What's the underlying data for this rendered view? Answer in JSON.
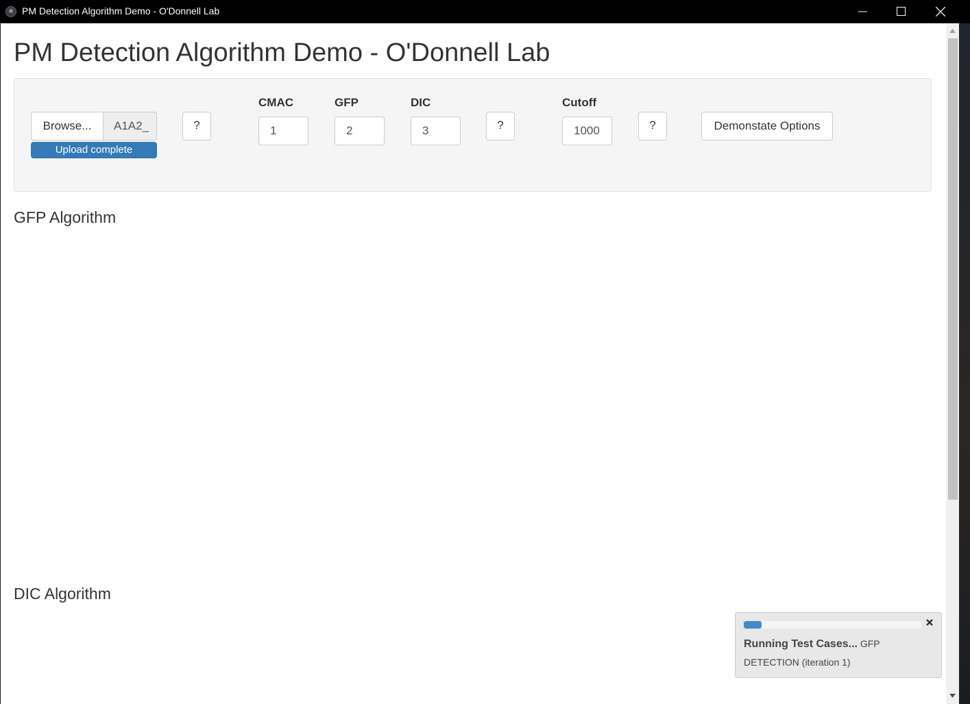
{
  "window": {
    "title": "PM Detection Algorithm Demo - O'Donnell Lab"
  },
  "page": {
    "heading": "PM Detection Algorithm Demo - O'Donnell Lab"
  },
  "controls": {
    "browse_label": "Browse...",
    "file_name": "A1A2_",
    "upload_status": "Upload complete",
    "upload_progress_percent": 100,
    "help_label": "?",
    "cmac": {
      "label": "CMAC",
      "value": "1"
    },
    "gfp": {
      "label": "GFP",
      "value": "2"
    },
    "dic": {
      "label": "DIC",
      "value": "3"
    },
    "cutoff": {
      "label": "Cutoff",
      "value": "1000"
    },
    "demo_button": "Demonstate Options"
  },
  "sections": {
    "gfp_title": "GFP Algorithm",
    "dic_title": "DIC Algorithm"
  },
  "notification": {
    "message": "Running Test Cases...",
    "detail": "GFP DETECTION (iteration 1)",
    "progress_percent": 10
  },
  "colors": {
    "primary": "#337ab7",
    "notification_bar": "#428bca",
    "titlebar": "#000000"
  }
}
